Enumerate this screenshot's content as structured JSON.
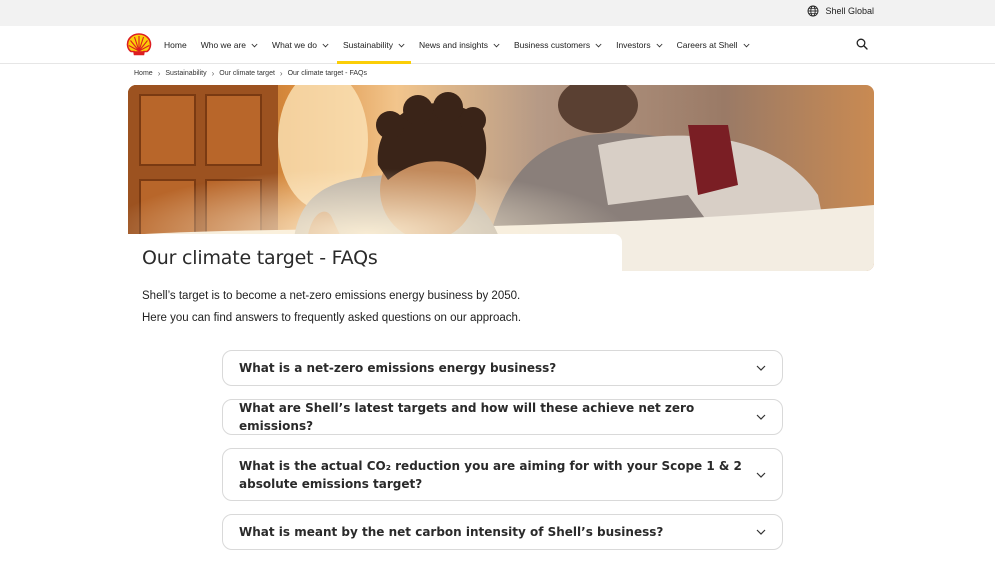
{
  "utility": {
    "region_label": "Shell Global",
    "region_icon": "globe-icon"
  },
  "nav": {
    "logo_icon": "shell-pecten-logo",
    "items": [
      {
        "label": "Home",
        "has_dropdown": false,
        "active": false
      },
      {
        "label": "Who we are",
        "has_dropdown": true,
        "active": false
      },
      {
        "label": "What we do",
        "has_dropdown": true,
        "active": false
      },
      {
        "label": "Sustainability",
        "has_dropdown": true,
        "active": true
      },
      {
        "label": "News and insights",
        "has_dropdown": true,
        "active": false
      },
      {
        "label": "Business customers",
        "has_dropdown": true,
        "active": false
      },
      {
        "label": "Investors",
        "has_dropdown": true,
        "active": false
      },
      {
        "label": "Careers at Shell",
        "has_dropdown": true,
        "active": false
      }
    ],
    "search_icon": "search-icon",
    "accent_color": "#fbce07"
  },
  "breadcrumb": [
    "Home",
    "Sustainability",
    "Our climate target",
    "Our climate target - FAQs"
  ],
  "page": {
    "title": "Our climate target - FAQs",
    "intro_1": "Shell’s target is to become a net-zero emissions energy business by 2050.",
    "intro_2": "Here you can find answers to frequently asked questions on our approach."
  },
  "faqs": [
    {
      "question": "What is a net-zero emissions energy business?"
    },
    {
      "question": "What are Shell’s latest targets and how will these achieve net zero emissions?"
    },
    {
      "question": "What is the actual CO₂ reduction you are aiming for with your Scope 1 & 2 absolute emissions target?"
    },
    {
      "question": "What is meant by the net carbon intensity of Shell’s business?"
    }
  ]
}
